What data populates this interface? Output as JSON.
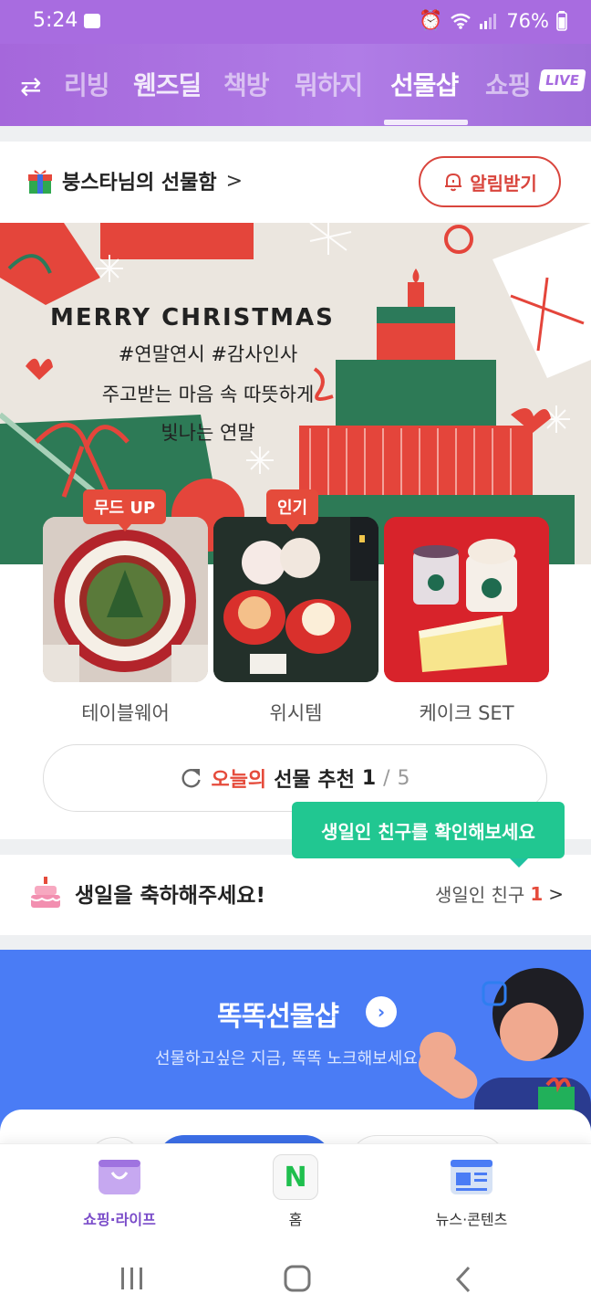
{
  "status": {
    "time": "5:24",
    "battery": "76%"
  },
  "topnav": {
    "items": [
      "리빙",
      "웬즈딜",
      "책방",
      "뭐하지",
      "선물샵",
      "쇼핑"
    ],
    "live_badge": "LIVE",
    "active": "선물샵"
  },
  "giftbox": {
    "title": "붕스타님의 선물함",
    "chevron": ">"
  },
  "notify_button": {
    "label": "알림받기"
  },
  "banner": {
    "title": "MERRY CHRISTMAS",
    "lines": [
      "#연말연시 #감사인사",
      "주고받는 마음 속 따뜻하게",
      "빛나는 연말"
    ]
  },
  "tiles": [
    {
      "badge": "무드 UP",
      "label": "테이블웨어"
    },
    {
      "badge": "인기",
      "label": "위시템"
    },
    {
      "badge": "",
      "label": "케이크 SET"
    }
  ],
  "recommend": {
    "highlight": "오늘의",
    "text": "선물 추천",
    "current": "1",
    "sep": "/",
    "total": "5"
  },
  "tooltip": {
    "text": "생일인 친구를 확인해보세요"
  },
  "birthday": {
    "title": "생일을 축하해주세요!",
    "friends_label": "생일인 친구",
    "count": "1"
  },
  "promo": {
    "title": "똑똑선물샵",
    "subtitle": "선물하고싶은 지금, 똑똑 노크해보세요"
  },
  "bottom_nav": [
    {
      "label": "쇼핑·라이프"
    },
    {
      "label": "홈",
      "icon_text": "N"
    },
    {
      "label": "뉴스·콘텐츠"
    }
  ],
  "colors": {
    "purple": "#a86ce0",
    "accent_red": "#e54b3b",
    "green": "#21c791",
    "blue": "#4a7cf5"
  }
}
